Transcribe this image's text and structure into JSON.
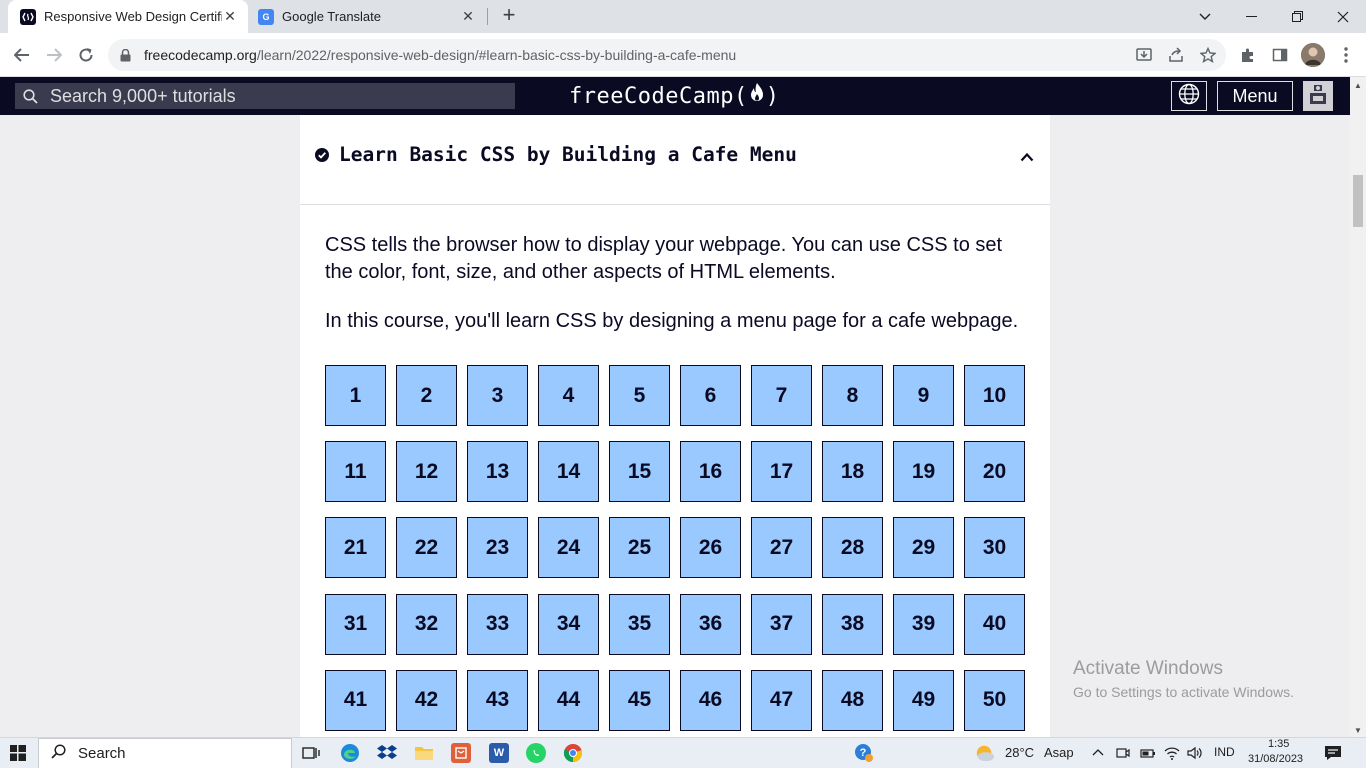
{
  "browser": {
    "tabs": [
      {
        "title": "Responsive Web Design Certificat",
        "favicon": "freecodecamp-favicon",
        "active": true
      },
      {
        "title": "Google Translate",
        "favicon": "google-translate-favicon",
        "active": false
      }
    ],
    "url_host": "freecodecamp.org",
    "url_path": "/learn/2022/responsive-web-design/#learn-basic-css-by-building-a-cafe-menu"
  },
  "fcc_nav": {
    "search_placeholder": "Search 9,000+ tutorials",
    "logo_left": "freeCodeCamp(",
    "logo_right": ")",
    "menu_label": "Menu"
  },
  "block": {
    "title": "Learn Basic CSS by Building a Cafe Menu",
    "description_1": "CSS tells the browser how to display your webpage. You can use CSS to set the color, font, size, and other aspects of HTML elements.",
    "description_2": "In this course, you'll learn CSS by designing a menu page for a cafe webpage.",
    "steps": [
      "1",
      "2",
      "3",
      "4",
      "5",
      "6",
      "7",
      "8",
      "9",
      "10",
      "11",
      "12",
      "13",
      "14",
      "15",
      "16",
      "17",
      "18",
      "19",
      "20",
      "21",
      "22",
      "23",
      "24",
      "25",
      "26",
      "27",
      "28",
      "29",
      "30",
      "31",
      "32",
      "33",
      "34",
      "35",
      "36",
      "37",
      "38",
      "39",
      "40",
      "41",
      "42",
      "43",
      "44",
      "45",
      "46",
      "47",
      "48",
      "49",
      "50"
    ]
  },
  "watermark": {
    "line1": "Activate Windows",
    "line2": "Go to Settings to activate Windows."
  },
  "taskbar": {
    "search_placeholder": "Search",
    "weather_temp": "28°C",
    "weather_label": "Asap",
    "language": "IND",
    "time": "1:35",
    "date": "31/08/2023"
  },
  "colors": {
    "fcc_nav_bg": "#0a0a23",
    "step_bg": "#99c9ff",
    "content_bg": "#ffffff",
    "page_bg": "#eeeef0"
  }
}
